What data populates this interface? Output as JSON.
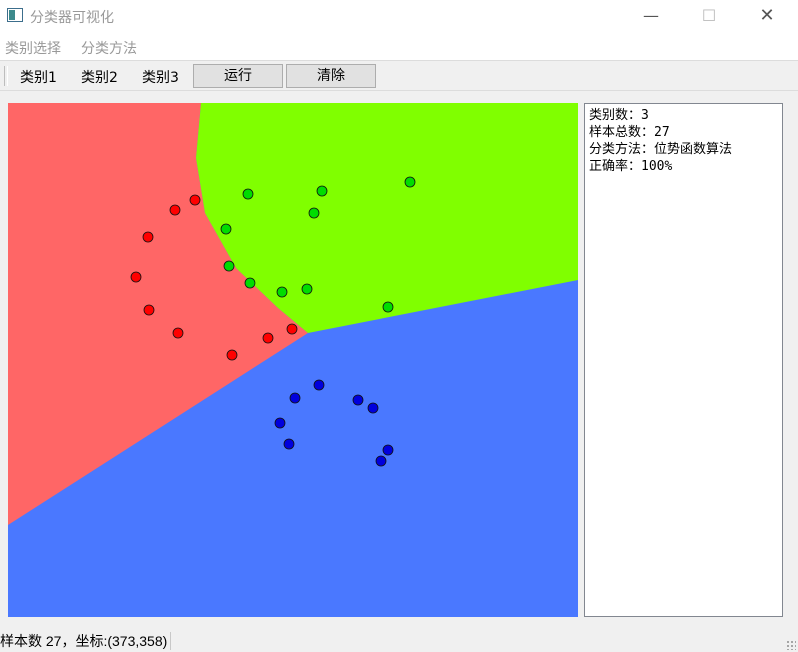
{
  "window": {
    "title": "分类器可视化",
    "minimize_glyph": "—",
    "maximize_glyph": "☐",
    "close_glyph": "✕"
  },
  "menu": {
    "items": [
      "类别选择",
      "分类方法"
    ]
  },
  "toolbar": {
    "class1_label": "类别1",
    "class2_label": "类别2",
    "class3_label": "类别3",
    "run_label": "运行",
    "clear_label": "清除"
  },
  "info": {
    "lines": [
      "类别数：3",
      "样本总数：27",
      "分类方法：位势函数算法",
      "正确率：100%"
    ]
  },
  "status": {
    "text": "样本数 27，坐标:(373,358)"
  },
  "chart_data": {
    "type": "scatter",
    "xlim": [
      0,
      570
    ],
    "ylim": [
      0,
      514
    ],
    "y_axis_direction": "down",
    "regions": [
      {
        "name": "class1",
        "color": "#ff6666"
      },
      {
        "name": "class2",
        "color": "#80ff00"
      },
      {
        "name": "class3",
        "color": "#4a78ff"
      }
    ],
    "region_boundaries": {
      "red_green_curve": [
        [
          193,
          0
        ],
        [
          188,
          55
        ],
        [
          197,
          110
        ],
        [
          228,
          165
        ],
        [
          270,
          205
        ],
        [
          300,
          230
        ]
      ],
      "triple_point": [
        300,
        230
      ],
      "green_blue_line": [
        [
          300,
          230
        ],
        [
          570,
          177
        ]
      ],
      "red_blue_line": [
        [
          300,
          230
        ],
        [
          0,
          422
        ]
      ]
    },
    "series": [
      {
        "name": "类别1",
        "color": "#ff0000",
        "points": [
          [
            187,
            97
          ],
          [
            167,
            107
          ],
          [
            140,
            134
          ],
          [
            128,
            174
          ],
          [
            141,
            207
          ],
          [
            170,
            230
          ],
          [
            224,
            252
          ],
          [
            260,
            235
          ],
          [
            284,
            226
          ]
        ]
      },
      {
        "name": "类别2",
        "color": "#00dd00",
        "points": [
          [
            240,
            91
          ],
          [
            314,
            88
          ],
          [
            402,
            79
          ],
          [
            306,
            110
          ],
          [
            218,
            126
          ],
          [
            221,
            163
          ],
          [
            242,
            180
          ],
          [
            274,
            189
          ],
          [
            299,
            186
          ],
          [
            380,
            204
          ]
        ]
      },
      {
        "name": "类别3",
        "color": "#0000dd",
        "points": [
          [
            311,
            282
          ],
          [
            287,
            295
          ],
          [
            350,
            297
          ],
          [
            365,
            305
          ],
          [
            272,
            320
          ],
          [
            281,
            341
          ],
          [
            380,
            347
          ],
          [
            373,
            358
          ]
        ]
      }
    ]
  }
}
